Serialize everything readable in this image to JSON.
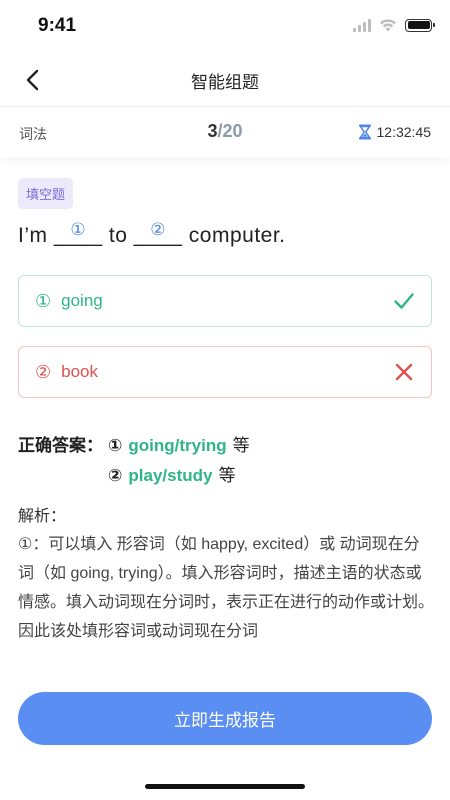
{
  "status_bar": {
    "time": "9:41"
  },
  "nav": {
    "title": "智能组题"
  },
  "info": {
    "category": "词法",
    "current": "3",
    "separator": "/",
    "total": "20",
    "timer": "12:32:45"
  },
  "question": {
    "type_badge": "填空题",
    "part1": "I’m ",
    "blank1_line": "____",
    "blank1_num": "①",
    "part2": " to ",
    "blank2_line": "____",
    "blank2_num": "②",
    "part3": " computer."
  },
  "answers": [
    {
      "num": "①",
      "text": "going",
      "status": "correct",
      "icon": "check-icon",
      "color": "#2fb587"
    },
    {
      "num": "②",
      "text": "book",
      "status": "wrong",
      "icon": "cross-icon",
      "color": "#e05050"
    }
  ],
  "correct_answer": {
    "label": "正确答案：",
    "items": [
      {
        "num": "①",
        "value": "going/trying",
        "suffix": "等"
      },
      {
        "num": "②",
        "value": "play/study",
        "suffix": "等"
      }
    ]
  },
  "analysis": {
    "label": "解析：",
    "text": "①：可以填入 形容词（如 happy, excited）或 动词现在分词（如 going, trying）。填入形容词时，描述主语的状态或情感。填入动词现在分词时，表示正在进行的动作或计划。因此该处填形容词或动词现在分词"
  },
  "action": {
    "generate_label": "立即生成报告"
  },
  "colors": {
    "accent": "#5b8ef2",
    "correct": "#2fb587",
    "wrong": "#e05050",
    "badge": "#7b6bd6"
  }
}
